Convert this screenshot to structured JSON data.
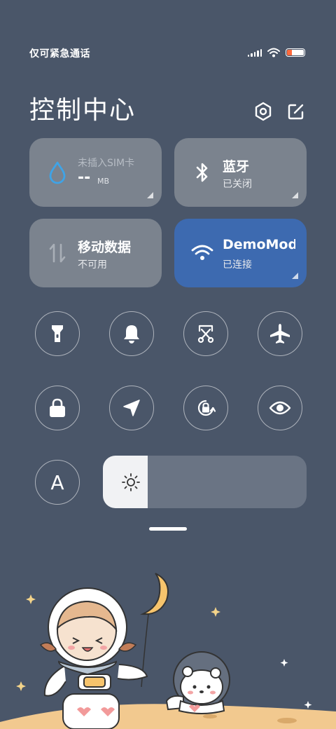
{
  "status_bar": {
    "carrier": "仅可紧急通话",
    "icons": [
      "signal-icon",
      "wifi-icon",
      "battery-icon"
    ]
  },
  "header": {
    "title": "控制中心",
    "settings_icon": "gear-icon",
    "edit_icon": "edit-icon"
  },
  "tiles": {
    "sim": {
      "label": "未插入SIM卡",
      "value": "--",
      "unit": "MB",
      "icon": "droplet-icon"
    },
    "bluetooth": {
      "title": "蓝牙",
      "status": "已关闭",
      "icon": "bluetooth-icon"
    },
    "mobile_data": {
      "title": "移动数据",
      "status": "不可用",
      "icon": "data-arrows-icon"
    },
    "wifi": {
      "title": "DemoMod",
      "status": "已连接",
      "icon": "wifi-icon",
      "active": true
    }
  },
  "toggles": [
    {
      "name": "flashlight",
      "icon": "flashlight-icon"
    },
    {
      "name": "ringer",
      "icon": "bell-icon"
    },
    {
      "name": "screenshot",
      "icon": "scissors-icon"
    },
    {
      "name": "airplane-mode",
      "icon": "airplane-icon"
    },
    {
      "name": "lock-screen",
      "icon": "lock-icon"
    },
    {
      "name": "location",
      "icon": "location-arrow-icon"
    },
    {
      "name": "rotation-lock",
      "icon": "rotation-lock-icon"
    },
    {
      "name": "reading-mode",
      "icon": "eye-icon"
    },
    {
      "name": "font-size",
      "icon": "font-a-icon",
      "label": "A"
    }
  ],
  "brightness": {
    "level": 0.22,
    "icon": "sun-icon"
  },
  "colors": {
    "background": "#4a5669",
    "tile": "#7b838e",
    "tile_active": "#3d6ab0",
    "accent_droplet": "#3fa3e6"
  }
}
